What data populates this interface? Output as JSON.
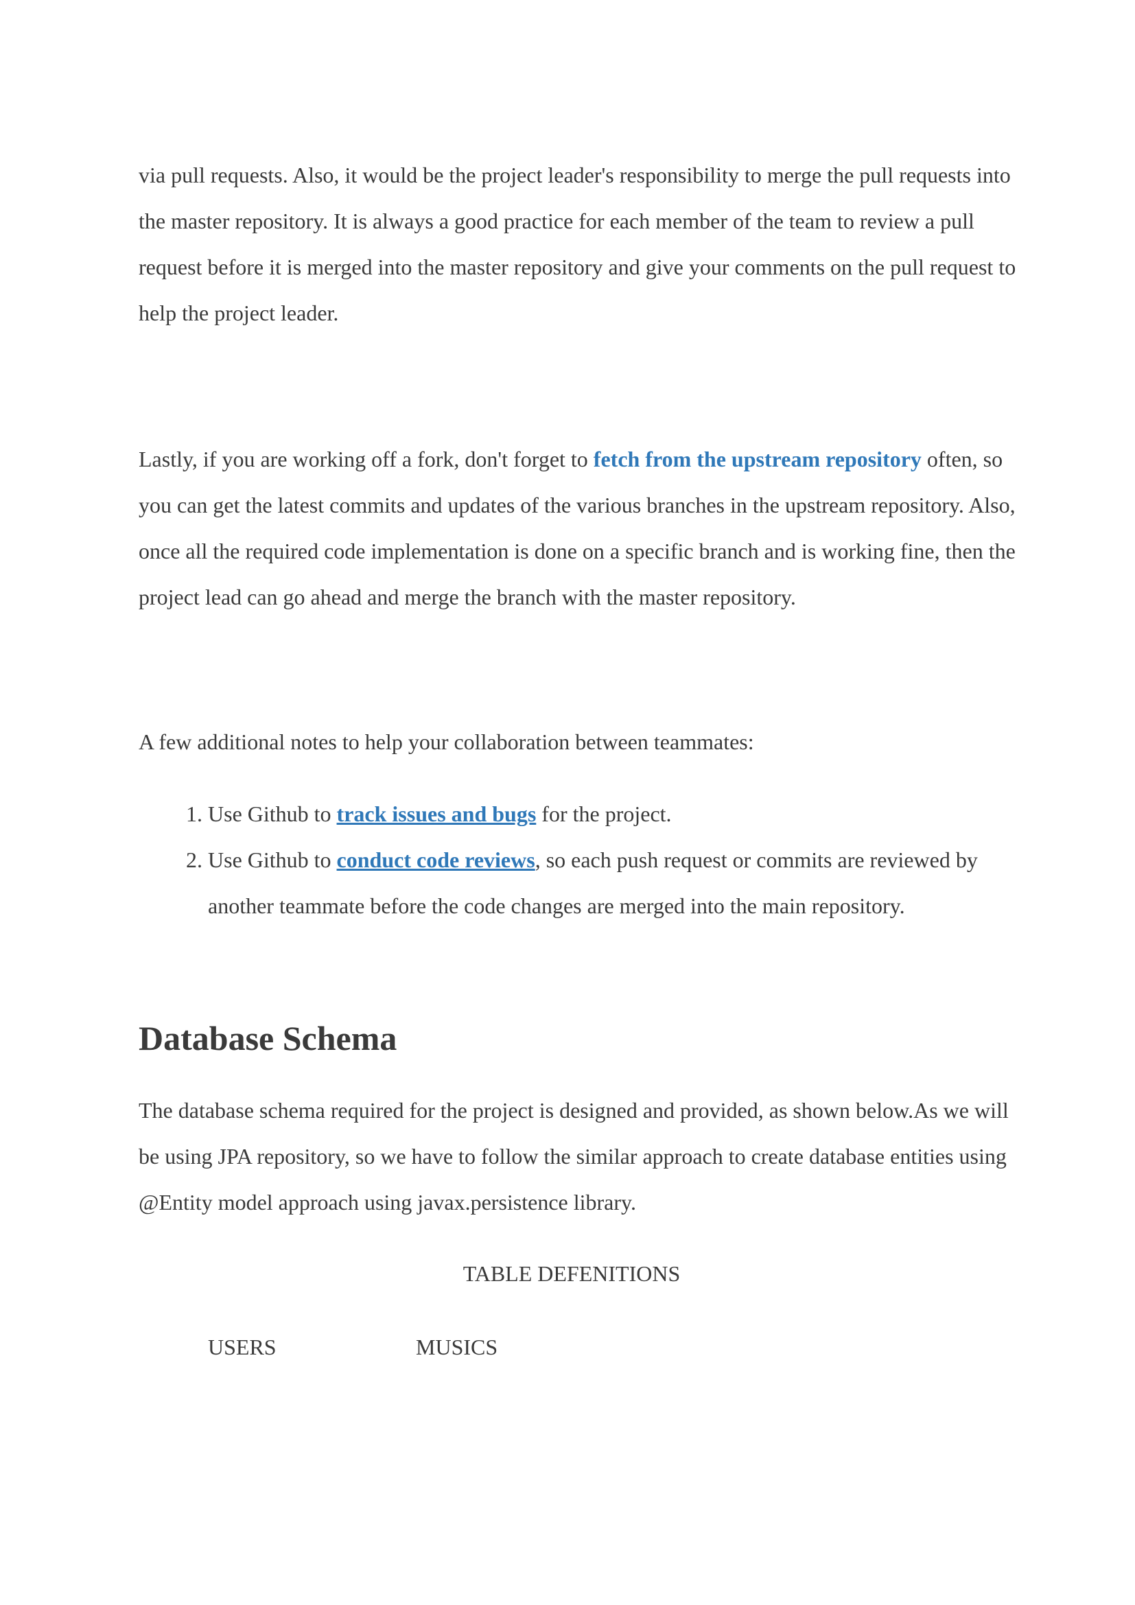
{
  "para1": {
    "text": "via pull requests. Also, it would be the project leader's responsibility to merge the pull requests into the master repository. It is always a good practice for each member of the team to review a pull request before it is merged into the master repository and give your comments on the pull request to help the project leader."
  },
  "para2": {
    "before_link": "Lastly, if you are working off a fork, don't forget to",
    "link": " fetch from the upstream repository",
    "after_link": " often, so you can get the latest commits and updates of the various branches in the upstream repository. Also, once all the required code implementation is done on a specific branch and is working fine, then the project lead can go ahead and merge the branch with the master repository."
  },
  "notes": {
    "intro": "A few additional notes to help your collaboration between teammates:",
    "items": [
      {
        "before_link": "Use Github to ",
        "link": "track issues and bugs",
        "after_link": " for the project."
      },
      {
        "before_link": "Use Github to ",
        "link": "conduct code reviews",
        "after_link": ", so each push request or commits are reviewed by another teammate before the code changes are merged into the main repository."
      }
    ]
  },
  "schema": {
    "heading": "Database Schema",
    "description": "The database schema required for the project is designed and provided, as shown below.As we will be using JPA repository, so we have to follow the similar approach to create database entities using @Entity model approach using javax.persistence library.",
    "table_title": "TABLE DEFENITIONS",
    "tables": [
      "USERS",
      "MUSICS"
    ]
  }
}
